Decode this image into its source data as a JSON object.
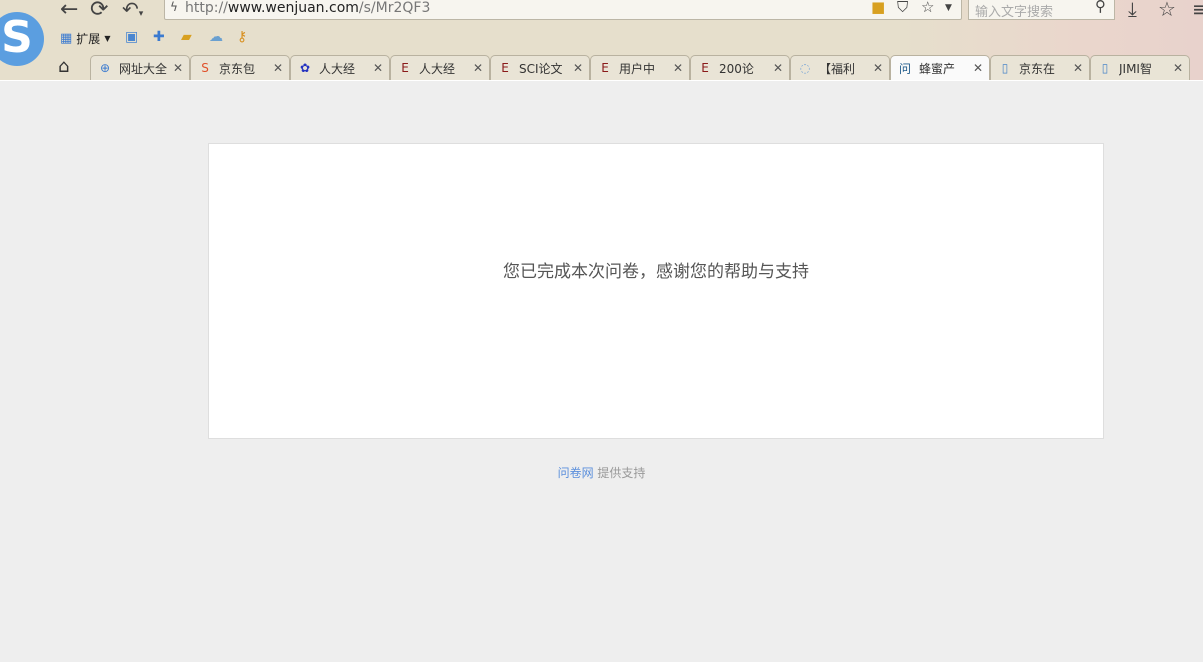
{
  "browser": {
    "logo": "S",
    "url_prefix": "http://",
    "url_host": "www.wenjuan.com",
    "url_path": "/s/Mr2QF3",
    "search_placeholder": "输入文字搜索",
    "extensions_label": "扩展",
    "tabs": [
      {
        "label": "网址大全",
        "icon": "globe-icon",
        "icon_char": "⊕",
        "icon_color": "#3a7ad0"
      },
      {
        "label": "京东包",
        "icon": "sogou-icon",
        "icon_char": "S",
        "icon_color": "#e0502a"
      },
      {
        "label": "人大经",
        "icon": "baidu-paw-icon",
        "icon_char": "✿",
        "icon_color": "#2432c0"
      },
      {
        "label": "人大经",
        "icon": "e-icon",
        "icon_char": "E",
        "icon_color": "#8a1a1a"
      },
      {
        "label": "SCI论文",
        "icon": "e-icon",
        "icon_char": "E",
        "icon_color": "#8a1a1a"
      },
      {
        "label": "用户中",
        "icon": "e-icon",
        "icon_char": "E",
        "icon_color": "#8a1a1a"
      },
      {
        "label": "200论",
        "icon": "e-icon",
        "icon_char": "E",
        "icon_color": "#8a1a1a"
      },
      {
        "label": "【福利",
        "icon": "loading-icon",
        "icon_char": "◌",
        "icon_color": "#7aa6d6"
      },
      {
        "label": "蜂蜜产",
        "icon": "wenjuan-icon",
        "icon_char": "问",
        "icon_color": "#1e5a8a",
        "active": true
      },
      {
        "label": "京东在",
        "icon": "page-icon",
        "icon_char": "▯",
        "icon_color": "#4a86c8"
      },
      {
        "label": "JIMI智",
        "icon": "page-icon",
        "icon_char": "▯",
        "icon_color": "#4a86c8"
      }
    ]
  },
  "page": {
    "message": "您已完成本次问卷，感谢您的帮助与支持",
    "footer_link": "问卷网",
    "footer_text": "提供支持"
  }
}
